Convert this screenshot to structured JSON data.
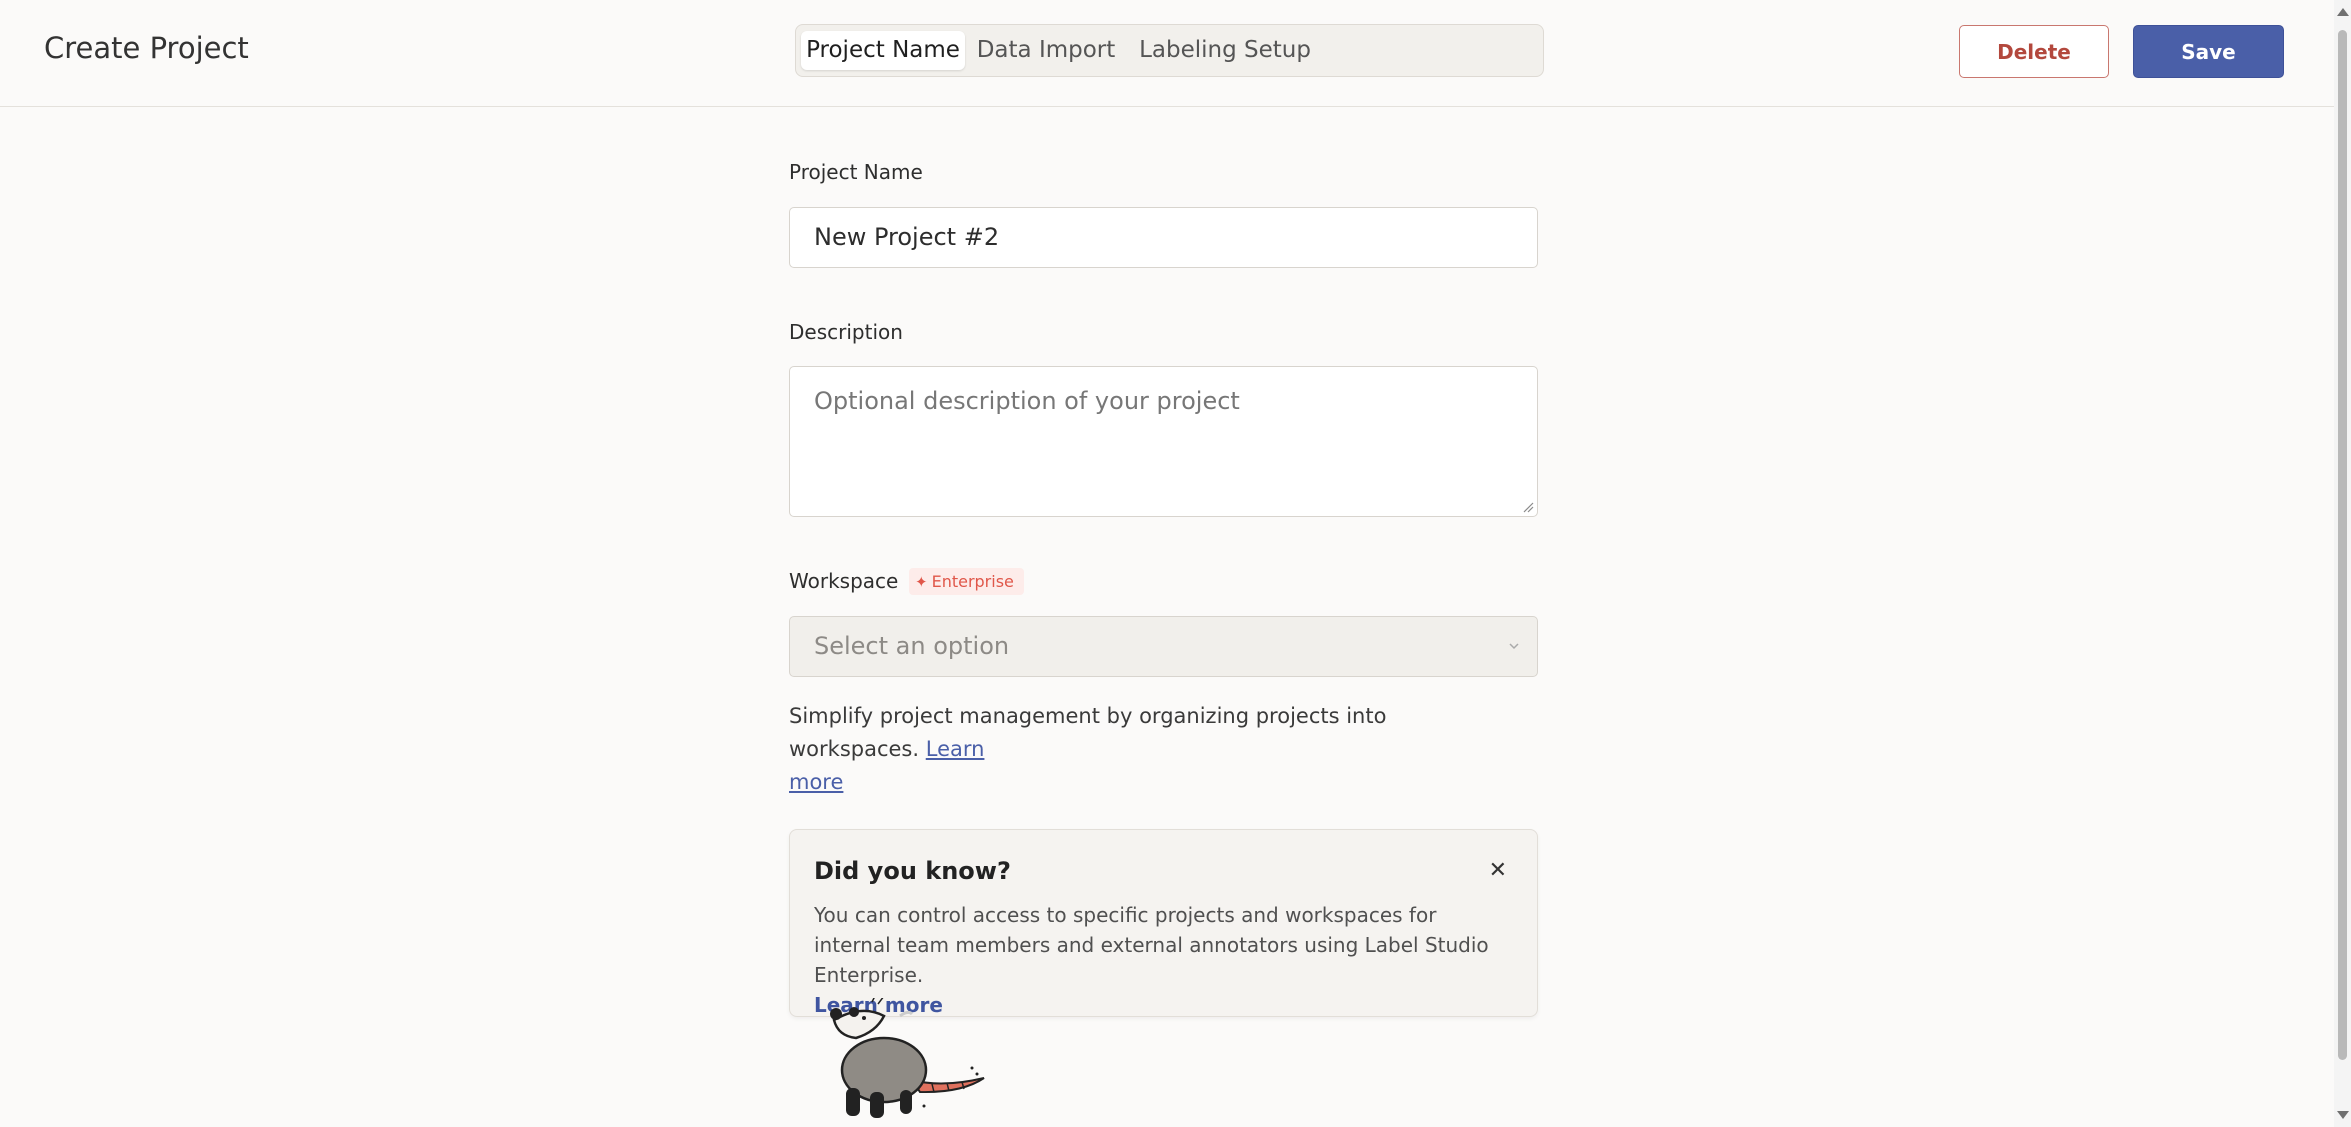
{
  "header": {
    "title": "Create Project",
    "tabs": [
      {
        "label": "Project Name",
        "active": true
      },
      {
        "label": "Data Import",
        "active": false
      },
      {
        "label": "Labeling Setup",
        "active": false
      }
    ],
    "delete_label": "Delete",
    "save_label": "Save"
  },
  "form": {
    "project_name_label": "Project Name",
    "project_name_value": "New Project #2",
    "description_label": "Description",
    "description_placeholder": "Optional description of your project",
    "workspace_label": "Workspace",
    "enterprise_badge": "Enterprise",
    "workspace_placeholder": "Select an option",
    "workspace_help_text": "Simplify project management by organizing projects into workspaces.",
    "workspace_help_link_1": "Learn",
    "workspace_help_link_2": "more"
  },
  "tip_card": {
    "title": "Did you know?",
    "close_glyph": "✕",
    "body": "You can control access to specific projects and workspaces for internal team members and external annotators using Label Studio Enterprise.",
    "link": "Learn more"
  },
  "colors": {
    "primary": "#4a5fa8",
    "danger": "#b3483d",
    "enterprise": "#e0574a",
    "background": "#fbfaf9"
  },
  "icons": [
    "sparkle-icon",
    "chevron-down-icon",
    "close-icon",
    "opossum-mascot-icon"
  ]
}
